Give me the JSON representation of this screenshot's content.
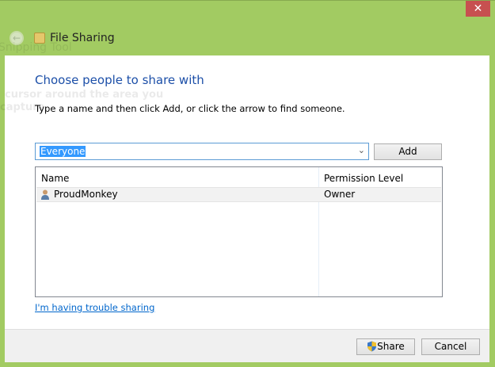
{
  "window": {
    "title": "File Sharing",
    "close_glyph": "✕"
  },
  "ghost": {
    "title": "Snipping Tool",
    "line1": "cursor around the area you",
    "line2": "capture."
  },
  "main": {
    "heading": "Choose people to share with",
    "instruction": "Type a name and then click Add, or click the arrow to find someone.",
    "combo_value": "Everyone",
    "add_label": "Add",
    "columns": [
      "Name",
      "Permission Level"
    ],
    "rows": [
      {
        "name": "ProudMonkey",
        "permission": "Owner"
      }
    ],
    "trouble_link": "I'm having trouble sharing"
  },
  "footer": {
    "share_label": "Share",
    "cancel_label": "Cancel"
  }
}
